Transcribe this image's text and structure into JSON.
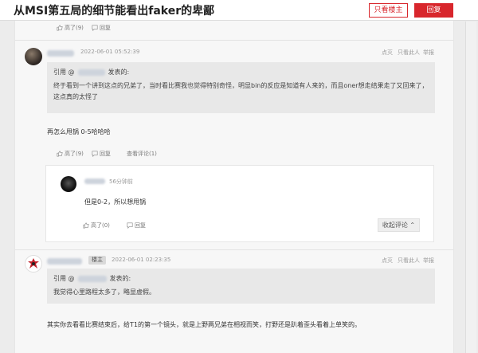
{
  "header": {
    "title": "从MSI第五局的细节能看出faker的卑鄙",
    "only_op_label": "只看楼主",
    "reply_label": "回复"
  },
  "top_actions": {
    "like": "高了(9)",
    "reply": "回复"
  },
  "post1": {
    "time": "2022-06-01 05:52:39",
    "actions_right": [
      "点灭",
      "只看此人",
      "举报"
    ],
    "quote": {
      "prefix": "引用 @",
      "suffix": "发表的:",
      "text": "终于看到一个讲到这点的兄弟了，当时看比赛我也觉得特别奇怪，明显bin的反应是知道有人来的，而且oner想走结果走了又回来了，这点真的太怪了"
    },
    "body": "再怎么甩锅 0-5哈哈哈",
    "actions": {
      "like": "高了(9)",
      "reply": "回复",
      "view_comments": "查看评论(1)"
    }
  },
  "comment": {
    "time": "56分钟前",
    "text": "但是0-2，所以想甩锅",
    "actions": {
      "like": "高了(0)",
      "reply": "回复"
    },
    "collapse_label": "收起评论"
  },
  "post2": {
    "badge": "楼主",
    "time": "2022-06-01 02:23:35",
    "actions_right": [
      "点灭",
      "只看此人",
      "举报"
    ],
    "quote": {
      "prefix": "引用 @",
      "suffix": "发表的:",
      "text": "我觉得心里路程太多了，略显虚假。"
    },
    "body": "其实你去看看比赛结束后，给T1的第一个镜头，就是上野两兄弟在相视而笑，打野还是趴着歪头看着上单笑的。"
  },
  "colors": {
    "accent": "#d8262c",
    "quote_bg": "#e8e8e8",
    "panel_bg": "#f7f7f7"
  }
}
